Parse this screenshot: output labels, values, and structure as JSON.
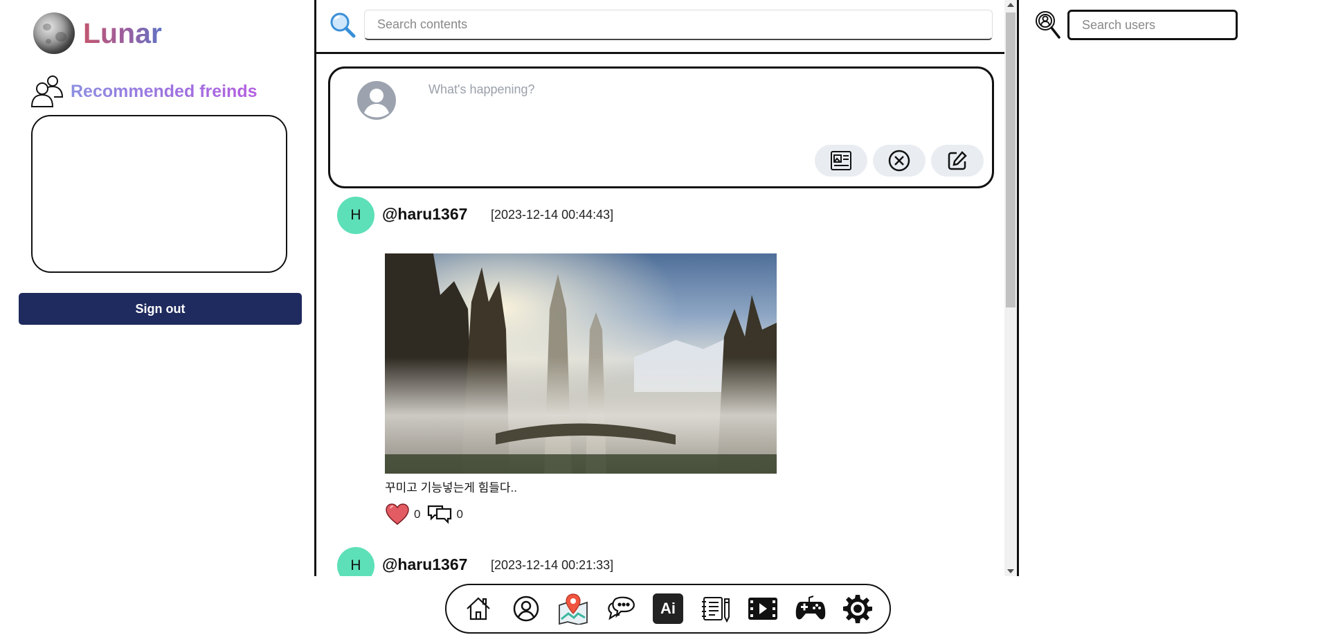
{
  "app": {
    "name": "Lunar"
  },
  "sidebar": {
    "recommended_title": "Recommended freinds",
    "signout_label": "Sign out"
  },
  "search": {
    "placeholder": "Search contents"
  },
  "composer": {
    "placeholder": "What's happening?",
    "buttons": [
      "image-upload-icon",
      "close-circle-icon",
      "edit-icon"
    ]
  },
  "posts": [
    {
      "avatar_letter": "H",
      "handle": "@haru1367",
      "time": "[2023-12-14 00:44:43]",
      "text": "꾸미고 기능넣는게 힘들다..",
      "likes": "0",
      "comments": "0"
    },
    {
      "avatar_letter": "H",
      "handle": "@haru1367",
      "time": "[2023-12-14 00:21:33]"
    }
  ],
  "user_search": {
    "placeholder": "Search users"
  },
  "bottom_nav": {
    "items": [
      "home-icon",
      "profile-icon",
      "map-icon",
      "chat-icon",
      "ai-icon",
      "notebook-icon",
      "video-icon",
      "game-icon",
      "settings-icon"
    ],
    "ai_label": "Ai"
  },
  "colors": {
    "signout_bg": "#1f2a5e",
    "avatar_bg": "#5de0b8",
    "heart": "#e35b63"
  }
}
